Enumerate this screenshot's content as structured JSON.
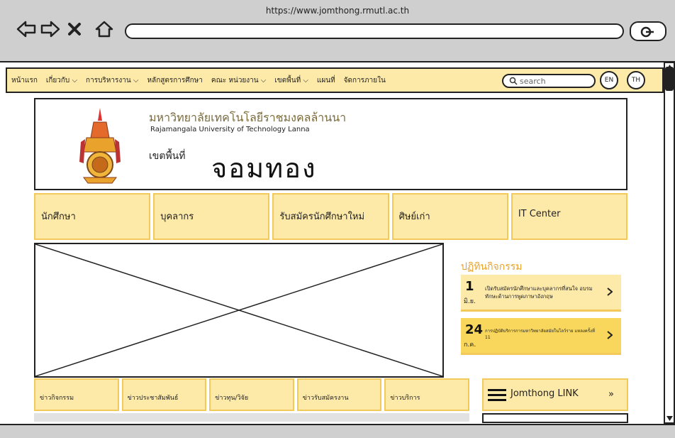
{
  "browser": {
    "url": "https://www.jomthong.rmutl.ac.th",
    "icons": [
      "back-arrow-icon",
      "forward-arrow-icon",
      "close-icon",
      "home-icon",
      "search-icon"
    ]
  },
  "nav": {
    "items": [
      "หน้าแรก",
      "เกี่ยวกับ ⌵",
      "การบริหารงาน ⌵",
      "หลักสูตรการศึกษา",
      "คณะ หน่วยงาน ⌵",
      "เขตพื้นที่ ⌵",
      "แผนที่",
      "จัดการภายใน"
    ],
    "search_placeholder": "search",
    "lang_en": "EN",
    "lang_th": "TH"
  },
  "header": {
    "uni_name_th": "มหาวิทยาลัยเทคโนโลยีราชมงคลล้านนา",
    "uni_name_en": "Rajamangala University of Technology Lanna",
    "campus_label": "เขตพื้นที่",
    "campus_name": "จอมทอง"
  },
  "main_menu": [
    "นักศึกษา",
    "บุคลากร",
    "รับสมัครนักศึกษาใหม่",
    "ศิษย์เก่า",
    "IT Center"
  ],
  "calendar": {
    "title": "ปฏิทินกิจกรรม",
    "events": [
      {
        "day": "1",
        "month": "มิ.ย.",
        "text": "เปิดรับสมัครนักศึกษาและบุคลากรที่สนใจ อบรมทักษะด้านการพูดภาษาอังกฤษ"
      },
      {
        "day": "24",
        "month": "ก.ค.",
        "text": "การปฏิบัติบริการการมหาวิทยาลัยสมัยในโลว์ราย แหลงครั้งที่ 11"
      }
    ]
  },
  "news_tabs": [
    "ข่าวกิจกรรม",
    "ข่าวประชาสัมพันธ์",
    "ข่าวทุน/วิจัย",
    "ข่าวรับสมัครงาน",
    "ข่าวบริการ"
  ],
  "link_box": {
    "label": "Jomthong LINK",
    "chevron": "»"
  },
  "colors": {
    "accent": "#fde9a8",
    "accent_dark": "#f3c95c",
    "event_alt": "#f8d75c",
    "title_orange": "#e9a32d"
  }
}
